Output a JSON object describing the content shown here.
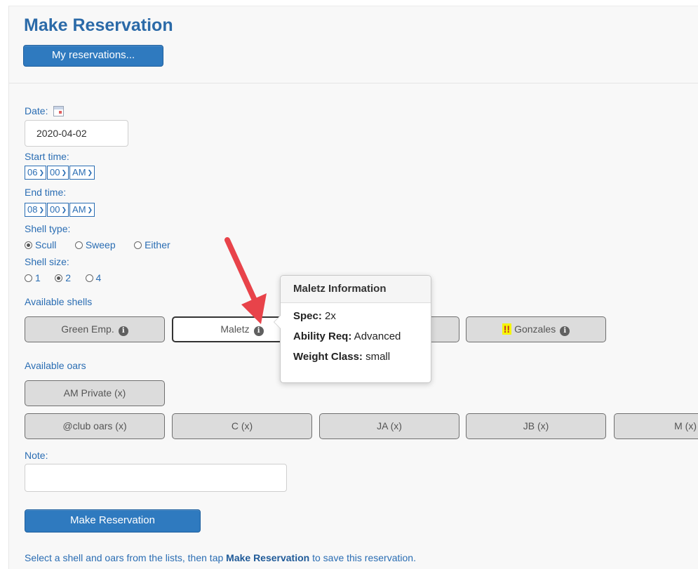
{
  "header": {
    "title": "Make Reservation",
    "my_reservations_label": "My reservations..."
  },
  "form": {
    "date_label": "Date:",
    "date_value": "2020-04-02",
    "start_time_label": "Start time:",
    "start_time": {
      "hour": "06",
      "minute": "00",
      "ampm": "AM"
    },
    "end_time_label": "End time:",
    "end_time": {
      "hour": "08",
      "minute": "00",
      "ampm": "AM"
    },
    "shell_type_label": "Shell type:",
    "shell_type_options": [
      "Scull",
      "Sweep",
      "Either"
    ],
    "shell_type_selected": "Scull",
    "shell_size_label": "Shell size:",
    "shell_size_options": [
      "1",
      "2",
      "4"
    ],
    "shell_size_selected": "2",
    "available_shells_label": "Available shells",
    "shells": [
      "Green Emp.",
      "Maletz",
      "Gonzales"
    ],
    "shell_selected": "Maletz",
    "gonzales_warning": "!!",
    "available_oars_label": "Available oars",
    "oars_row1": [
      "AM Private (x)"
    ],
    "oars_row2": [
      "@club oars (x)",
      "C (x)",
      "JA (x)",
      "JB (x)",
      "M (x)"
    ],
    "note_label": "Note:",
    "note_value": "",
    "submit_label": "Make Reservation"
  },
  "footer": {
    "text_before": "Select a shell and oars from the lists, then tap ",
    "text_bold": "Make Reservation",
    "text_after": " to save this reservation."
  },
  "popover": {
    "title": "Maletz Information",
    "spec_label": "Spec:",
    "spec_value": " 2x",
    "ability_label": "Ability Req:",
    "ability_value": " Advanced",
    "weight_label": "Weight Class:",
    "weight_value": " small"
  },
  "colors": {
    "link_blue": "#2a6db3",
    "button_blue": "#2f7abf",
    "chip_gray": "#dcdcdc",
    "arrow_red": "#e8434a",
    "warn_yellow": "#f5f500"
  }
}
